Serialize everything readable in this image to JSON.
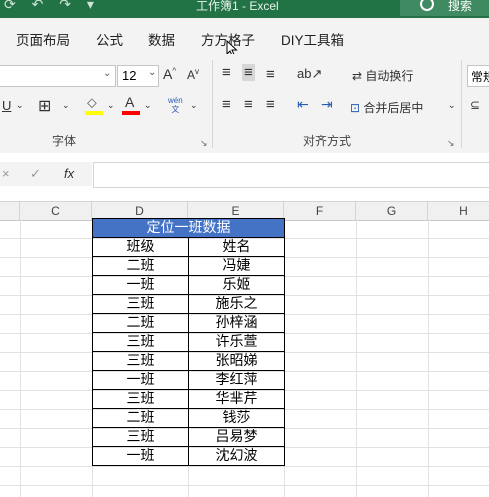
{
  "window": {
    "title": "工作簿1 - Excel",
    "search_label": "搜索"
  },
  "tabs": [
    "页面布局",
    "公式",
    "数据",
    "方方格子",
    "DIY工具箱"
  ],
  "ribbon": {
    "font_size": "12",
    "grow_font": "A",
    "shrink_font": "A",
    "wrap_text": "自动换行",
    "merge_center": "合并后居中",
    "number_format": "常规",
    "font_group_label": "字体",
    "align_group_label": "对齐方式",
    "phonetic_label": "wén"
  },
  "formula_bar": {
    "fx_label": "fx"
  },
  "columns": [
    "C",
    "D",
    "E",
    "F",
    "G",
    "H"
  ],
  "table": {
    "title": "定位一班数据",
    "headers": [
      "班级",
      "姓名"
    ],
    "rows": [
      [
        "二班",
        "冯婕"
      ],
      [
        "一班",
        "乐姬"
      ],
      [
        "三班",
        "施乐之"
      ],
      [
        "二班",
        "孙梓涵"
      ],
      [
        "三班",
        "许乐萱"
      ],
      [
        "三班",
        "张昭娣"
      ],
      [
        "一班",
        "李红萍"
      ],
      [
        "三班",
        "华芈芹"
      ],
      [
        "二班",
        "钱莎"
      ],
      [
        "三班",
        "吕易梦"
      ],
      [
        "一班",
        "沈幻波"
      ]
    ]
  },
  "colors": {
    "excel_green": "#217346",
    "header_fill": "#4472c4",
    "highlight_yellow": "#ffff00",
    "font_red": "#ff0000"
  }
}
